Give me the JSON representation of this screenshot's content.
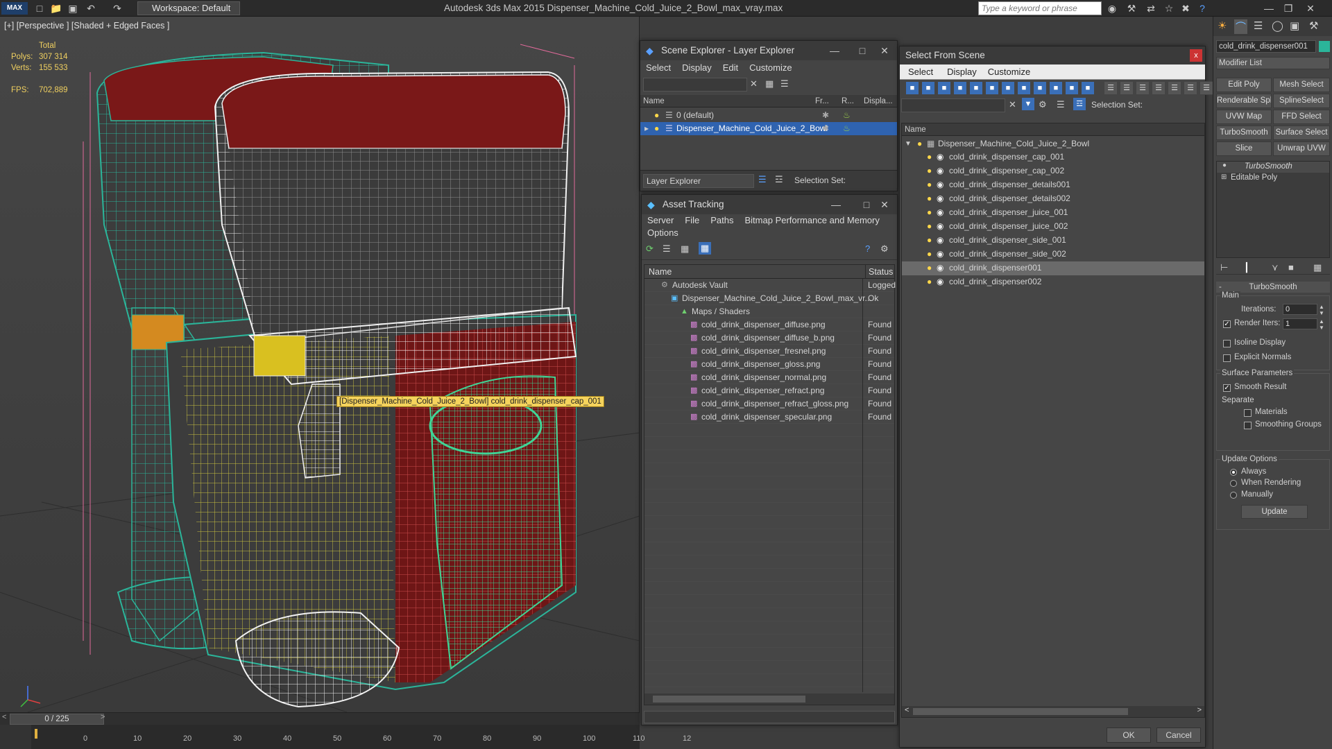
{
  "titlebar": {
    "logo": "MAX",
    "workspace": "Workspace: Default",
    "app_title": "Autodesk 3ds Max  2015      Dispenser_Machine_Cold_Juice_2_Bowl_max_vray.max",
    "search_placeholder": "Type a keyword or phrase"
  },
  "viewport": {
    "label": "[+] [Perspective ] [Shaded + Edged Faces ]",
    "stats": {
      "total_label": "Total",
      "polys_label": "Polys:",
      "polys": "307 314",
      "verts_label": "Verts:",
      "verts": "155 533",
      "fps_label": "FPS:",
      "fps": "702,889"
    },
    "tooltip": "[Dispenser_Machine_Cold_Juice_2_Bowl] cold_drink_dispenser_cap_001"
  },
  "timeline": {
    "slider": "0 / 225",
    "ticks": [
      "0",
      "10",
      "20",
      "30",
      "40",
      "50",
      "60",
      "70",
      "80",
      "90",
      "100",
      "110",
      "12"
    ]
  },
  "scene_explorer": {
    "title": "Scene Explorer - Layer Explorer",
    "menu": [
      "Select",
      "Display",
      "Edit",
      "Customize"
    ],
    "columns": [
      "Name",
      "Fr...",
      "R...",
      "Displa..."
    ],
    "rows": [
      {
        "name": "0 (default)",
        "selected": false
      },
      {
        "name": "Dispenser_Machine_Cold_Juice_2_Bowl",
        "selected": true
      }
    ],
    "footer_select": "Layer Explorer",
    "selection_set": "Selection Set:"
  },
  "asset_tracking": {
    "title": "Asset Tracking",
    "menu": [
      "Server",
      "File",
      "Paths",
      "Bitmap Performance and Memory"
    ],
    "menu2": [
      "Options"
    ],
    "columns": [
      "Name",
      "Status"
    ],
    "rows": [
      {
        "name": "Autodesk Vault",
        "status": "Logged",
        "indent": 0
      },
      {
        "name": "Dispenser_Machine_Cold_Juice_2_Bowl_max_vr...",
        "status": "Ok",
        "indent": 1
      },
      {
        "name": "Maps / Shaders",
        "status": "",
        "indent": 2
      },
      {
        "name": "cold_drink_dispenser_diffuse.png",
        "status": "Found",
        "indent": 3
      },
      {
        "name": "cold_drink_dispenser_diffuse_b.png",
        "status": "Found",
        "indent": 3
      },
      {
        "name": "cold_drink_dispenser_fresnel.png",
        "status": "Found",
        "indent": 3
      },
      {
        "name": "cold_drink_dispenser_gloss.png",
        "status": "Found",
        "indent": 3
      },
      {
        "name": "cold_drink_dispenser_normal.png",
        "status": "Found",
        "indent": 3
      },
      {
        "name": "cold_drink_dispenser_refract.png",
        "status": "Found",
        "indent": 3
      },
      {
        "name": "cold_drink_dispenser_refract_gloss.png",
        "status": "Found",
        "indent": 3
      },
      {
        "name": "cold_drink_dispenser_specular.png",
        "status": "Found",
        "indent": 3
      }
    ]
  },
  "select_from_scene": {
    "title": "Select From Scene",
    "menu": [
      "Select",
      "Display",
      "Customize"
    ],
    "selection_set": "Selection Set:",
    "column": "Name",
    "root": "Dispenser_Machine_Cold_Juice_2_Bowl",
    "items": [
      {
        "name": "cold_drink_dispenser_cap_001",
        "selected": false
      },
      {
        "name": "cold_drink_dispenser_cap_002",
        "selected": false
      },
      {
        "name": "cold_drink_dispenser_details001",
        "selected": false
      },
      {
        "name": "cold_drink_dispenser_details002",
        "selected": false
      },
      {
        "name": "cold_drink_dispenser_juice_001",
        "selected": false
      },
      {
        "name": "cold_drink_dispenser_juice_002",
        "selected": false
      },
      {
        "name": "cold_drink_dispenser_side_001",
        "selected": false
      },
      {
        "name": "cold_drink_dispenser_side_002",
        "selected": false
      },
      {
        "name": "cold_drink_dispenser001",
        "selected": true
      },
      {
        "name": "cold_drink_dispenser002",
        "selected": false
      }
    ],
    "ok": "OK",
    "cancel": "Cancel"
  },
  "command_panel": {
    "object_name": "cold_drink_dispenser001",
    "modifier_list": "Modifier List",
    "buttons": [
      "Edit Poly",
      "Mesh Select",
      "Renderable Spline",
      "SplineSelect",
      "UVW Map",
      "FFD Select",
      "TurboSmooth",
      "Surface Select",
      "Slice",
      "Unwrap UVW"
    ],
    "stack": [
      "TurboSmooth",
      "Editable Poly"
    ],
    "rollout_title": "TurboSmooth",
    "main_label": "Main",
    "iterations_label": "Iterations:",
    "iterations": "0",
    "render_iters_label": "Render Iters:",
    "render_iters": "1",
    "isoline": "Isoline Display",
    "explicit_normals": "Explicit Normals",
    "surface_params": "Surface Parameters",
    "smooth_result": "Smooth Result",
    "separate": "Separate",
    "materials": "Materials",
    "smoothing_groups": "Smoothing Groups",
    "update_options": "Update Options",
    "always": "Always",
    "when_rendering": "When Rendering",
    "manually": "Manually",
    "update": "Update"
  },
  "colors": {
    "accent": "#4a90d9",
    "selected_row": "#2f63b0",
    "wire_red": "#8b1a1a",
    "wire_teal": "#2bb59a",
    "wire_yellow": "#c8c040"
  }
}
